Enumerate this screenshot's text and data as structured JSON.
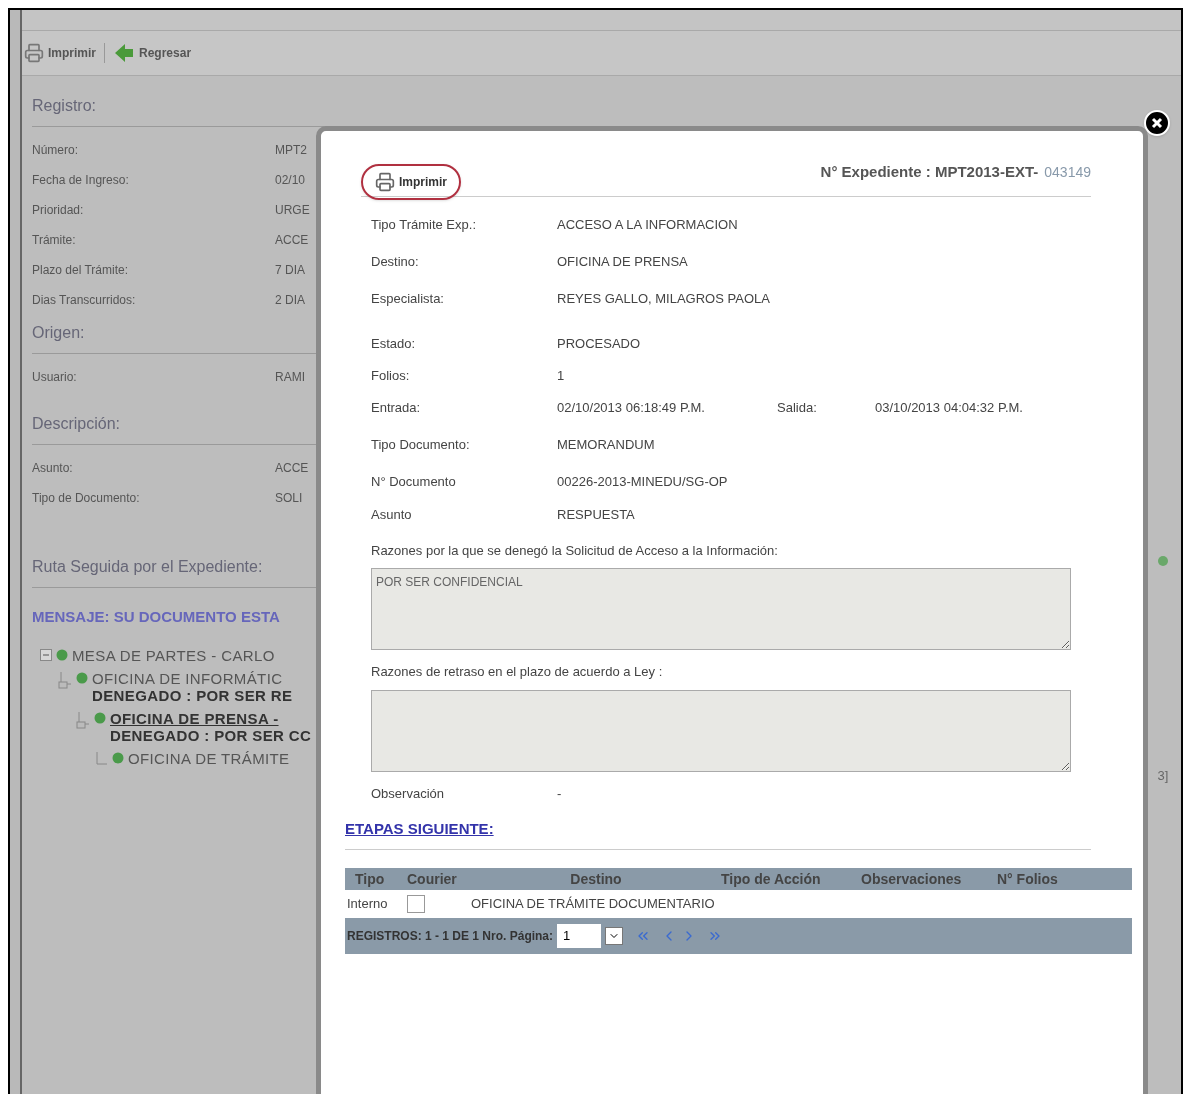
{
  "toolbar": [
    {
      "kind": "print",
      "label": "Imprimir"
    },
    {
      "kind": "back",
      "label": "Regresar"
    }
  ],
  "sections": [
    {
      "title": "Registro:",
      "fields": [
        {
          "label": "Número:",
          "value": "MPT2"
        },
        {
          "label": "Fecha de Ingreso:",
          "value": "02/10"
        },
        {
          "label": "Prioridad:",
          "value": "URGE"
        },
        {
          "label": "Trámite:",
          "value": "ACCE"
        },
        {
          "label": "Plazo del Trámite:",
          "value": "7 DIA"
        },
        {
          "label": "Dias Transcurridos:",
          "value": "2 DIA"
        }
      ]
    },
    {
      "title": "Origen:",
      "fields": [
        {
          "label": "Usuario:",
          "value": "RAMI"
        }
      ]
    },
    {
      "title": "Descripción:",
      "fields": [
        {
          "label": "Asunto:",
          "value": "ACCE"
        },
        {
          "label": "Tipo de Documento:",
          "value": "SOLI"
        }
      ]
    }
  ],
  "ruta": {
    "title": "Ruta Seguida por el Expediente:",
    "message": "MENSAJE: SU DOCUMENTO ESTA",
    "tree": [
      {
        "label": "MESA DE PARTES - CARLO",
        "selected": false,
        "expanded": true,
        "children": [
          {
            "label": "OFICINA DE INFORMÁTIC",
            "note": "DENEGADO : POR SER RE",
            "selected": false,
            "expanded": true,
            "children": [
              {
                "label": "OFICINA DE PRENSA -",
                "note": "DENEGADO : POR SER CC",
                "selected": true,
                "expanded": true,
                "children": [
                  {
                    "label": "OFICINA DE TRÁMITE",
                    "selected": false,
                    "expanded": false
                  }
                ]
              }
            ]
          }
        ]
      }
    ]
  },
  "right_edge": {
    "text": "3]"
  },
  "modal": {
    "print_label": "Imprimir",
    "expediente_label": "N° Expediente : MPT2013-EXT-",
    "expediente_number": "043149",
    "fields": [
      {
        "label": "Tipo Trámite Exp.:",
        "value": "ACCESO A LA INFORMACION"
      },
      {
        "label": "Destino:",
        "value": "OFICINA DE PRENSA"
      },
      {
        "label": "Especialista:",
        "value": "REYES GALLO, MILAGROS PAOLA"
      },
      {
        "label": "Estado:",
        "value": "PROCESADO"
      },
      {
        "label": "Folios:",
        "value": "1"
      },
      {
        "label": "Entrada:",
        "value": "02/10/2013 06:18:49 P.M.",
        "extra_label": "Salida:",
        "extra_value": "03/10/2013 04:04:32 P.M."
      },
      {
        "label": "Tipo Documento:",
        "value": "MEMORANDUM"
      },
      {
        "label": "N° Documento",
        "value": "00226-2013-MINEDU/SG-OP"
      },
      {
        "label": "Asunto",
        "value": "RESPUESTA"
      }
    ],
    "textareas": [
      {
        "label": "Razones por la que se denegó la Solicitud de Acceso a la Información:",
        "value": "POR SER CONFIDENCIAL"
      },
      {
        "label": "Razones de retraso en el plazo de acuerdo a Ley :"
      }
    ],
    "observation": {
      "label": "Observación",
      "value": "-"
    },
    "etapas": {
      "title": "ETAPAS SIGUIENTE:",
      "columns": [
        "Tipo",
        "Courier",
        "Destino",
        "Tipo de Acción",
        "Observaciones",
        "N° Folios"
      ],
      "rows": [
        {
          "tipo": "Interno",
          "courier": false,
          "destino": "OFICINA DE TRÁMITE DOCUMENTARIO"
        }
      ],
      "pager": {
        "text": "REGISTROS: 1 - 1 DE 1 Nro. Página:",
        "page": "1"
      }
    }
  }
}
